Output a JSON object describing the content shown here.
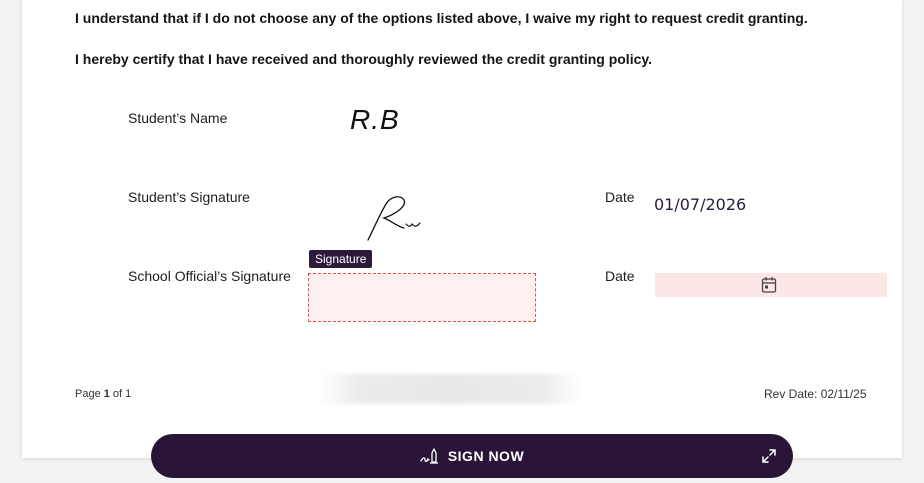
{
  "statements": {
    "waiver": "I understand that if I do not choose any of the options listed above, I waive my right to request credit granting.",
    "certify": "I hereby certify that I have received and thoroughly reviewed the credit granting policy."
  },
  "form": {
    "student_name_label": "Student’s Name",
    "student_name_value": "R.B",
    "student_signature_label": "Student’s Signature",
    "student_date_label": "Date",
    "student_date_value": "01/07/2026",
    "official_signature_label": "School Official’s Signature",
    "signature_tag": "Signature",
    "official_date_label": "Date"
  },
  "footer": {
    "page_prefix": "Page ",
    "page_current": "1",
    "page_of": " of ",
    "page_total": "1",
    "rev_date": "Rev Date: 02/11/25"
  },
  "action_bar": {
    "label": "SIGN NOW",
    "icon": "pen-signature-icon",
    "expand_icon": "expand-icon"
  },
  "colors": {
    "accent": "#2a1438",
    "field_required_bg": "#fff0f0",
    "field_required_border": "#d9534f"
  }
}
